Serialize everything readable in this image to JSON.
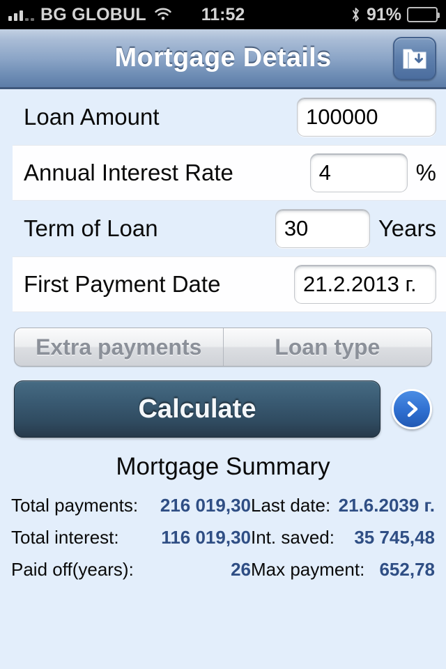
{
  "status_bar": {
    "carrier": "BG GLOBUL",
    "time": "11:52",
    "battery_percent": "91%",
    "signal_icon": "signal-bars-icon",
    "wifi_icon": "wifi-icon",
    "bluetooth_icon": "bluetooth-icon",
    "battery_icon": "battery-icon"
  },
  "nav": {
    "title": "Mortgage Details",
    "save_icon": "folder-save-icon"
  },
  "form": {
    "rows": [
      {
        "label": "Loan Amount",
        "value": "100000",
        "unit": ""
      },
      {
        "label": "Annual Interest Rate",
        "value": "4",
        "unit": "%"
      },
      {
        "label": "Term of Loan",
        "value": "30",
        "unit": "Years"
      },
      {
        "label": "First Payment Date",
        "value": "21.2.2013 г.",
        "unit": ""
      }
    ]
  },
  "segmented": {
    "extra_payments": "Extra payments",
    "loan_type": "Loan type"
  },
  "actions": {
    "calculate": "Calculate",
    "next_icon": "chevron-right-icon"
  },
  "summary": {
    "title": "Mortgage Summary",
    "rows": [
      {
        "left_label": "Total payments:",
        "left_value": "216 019,30",
        "right_label": "Last date:",
        "right_value": "21.6.2039 г."
      },
      {
        "left_label": "Total interest:",
        "left_value": "116 019,30",
        "right_label": "Int. saved:",
        "right_value": "35 745,48"
      },
      {
        "left_label": "Paid off(years):",
        "left_value": "26",
        "right_label": "Max payment:",
        "right_value": "652,78"
      }
    ]
  },
  "colors": {
    "page_background": "#e3eefb",
    "nav_bar_bottom": "#5d7da8",
    "summary_value": "#2f4e84",
    "calculate_button": "#2f4a5f",
    "next_arrow": "#2f6fd0"
  }
}
